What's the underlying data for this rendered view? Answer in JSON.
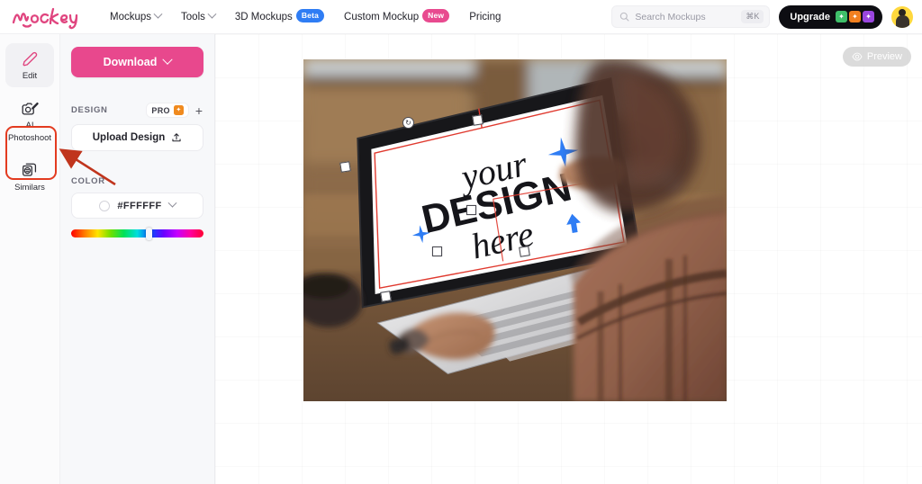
{
  "header": {
    "logo_text": "mockey",
    "logo_color": "#e0457f",
    "nav": [
      {
        "label": "Mockups",
        "has_chevron": true,
        "badge": null
      },
      {
        "label": "Tools",
        "has_chevron": true,
        "badge": null
      },
      {
        "label": "3D Mockups",
        "has_chevron": false,
        "badge": "Beta",
        "badge_color": "#2f7df4"
      },
      {
        "label": "Custom Mockup",
        "has_chevron": false,
        "badge": "New",
        "badge_color": "#e84a8f"
      },
      {
        "label": "Pricing",
        "has_chevron": false,
        "badge": null
      }
    ],
    "search": {
      "placeholder": "Search Mockups",
      "shortcut": "⌘K",
      "icon": "search-icon"
    },
    "upgrade": {
      "label": "Upgrade",
      "bg": "#0d0d12",
      "icons": [
        "sparkle-green",
        "sparkle-orange",
        "sparkle-purple"
      ]
    },
    "avatar": {
      "icon": "user-avatar",
      "bg": "#ffd83d"
    }
  },
  "rail": {
    "items": [
      {
        "label": "Edit",
        "icon": "pencil-icon",
        "active": false
      },
      {
        "label": "AI\nPhotoshoot",
        "label_line1": "AI",
        "label_line2": "Photoshoot",
        "icon": "ai-camera-icon",
        "active": true,
        "highlighted": true
      },
      {
        "label": "Similars",
        "icon": "similars-icon",
        "active": false
      }
    ],
    "highlight_color": "#e33b20",
    "annotation": {
      "type": "arrow",
      "color": "#c0351d",
      "points_to": "AI Photoshoot"
    }
  },
  "sidebar": {
    "download": {
      "label": "Download",
      "bg": "#e8488d",
      "icon": "chevron-down-icon"
    },
    "design": {
      "title": "DESIGN",
      "pro_label": "PRO",
      "pro_icon": "sparkle-orange-icon",
      "add_label": "+",
      "upload_label": "Upload Design",
      "upload_icon": "upload-icon"
    },
    "color": {
      "title": "COLOR",
      "hex": "#FFFFFF",
      "swatch_icon": "color-circle-icon",
      "chevron_icon": "chevron-down-icon",
      "hue_position_percent": 57
    }
  },
  "canvas": {
    "preview": {
      "label": "Preview",
      "icon": "eye-icon"
    },
    "mockup": {
      "scene": "person-typing-on-laptop",
      "design_overlay": {
        "line1": "your",
        "line2": "DESIGN",
        "line3": "here",
        "decorations": [
          "sparkle-blue-large",
          "sparkle-blue-small",
          "arrow-blue-up"
        ],
        "selection_color": "#e03a2f",
        "handles": [
          "rotate",
          "corner-tl",
          "corner-tr",
          "corner-br",
          "corner-bl",
          "mid-right",
          "mid-bottom"
        ]
      }
    }
  }
}
